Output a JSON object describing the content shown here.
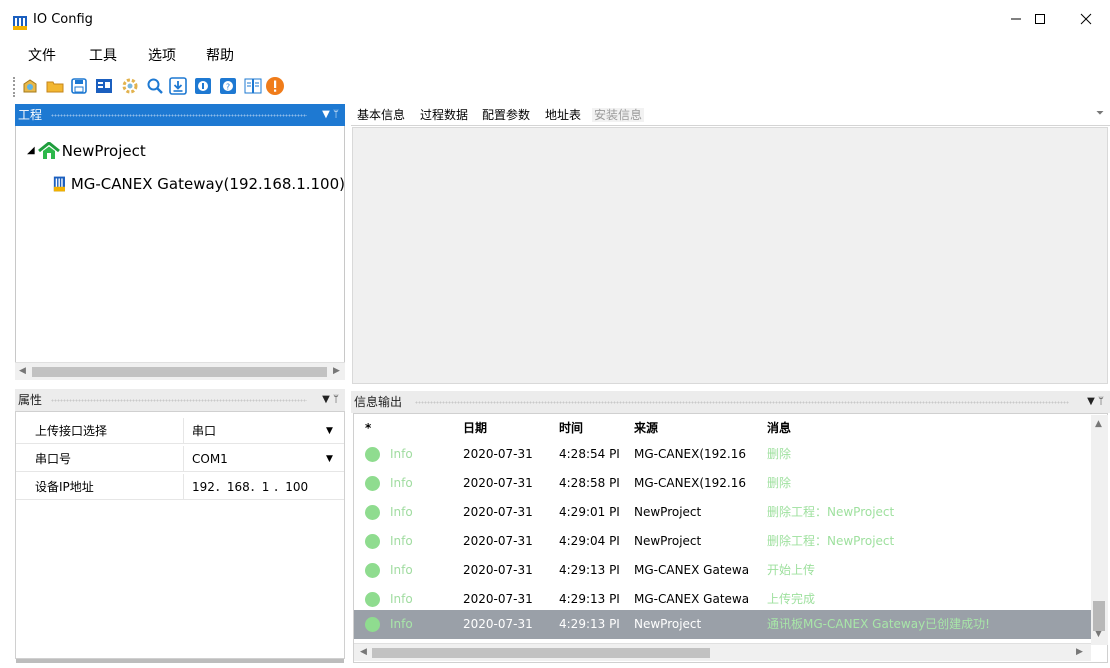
{
  "window": {
    "title": "IO Config"
  },
  "menu": [
    "文件",
    "工具",
    "选项",
    "帮助"
  ],
  "toolbar": [
    "new-project-icon",
    "open-folder-icon",
    "save-icon",
    "config-icon",
    "settings-gear-icon",
    "search-icon",
    "download-icon",
    "info-icon",
    "help-icon",
    "manual-icon",
    "warning-icon"
  ],
  "project_panel": {
    "title": "工程",
    "root": "NewProject",
    "child": "MG-CANEX Gateway(192.168.1.100)"
  },
  "tabs": [
    "基本信息",
    "过程数据",
    "配置参数",
    "地址表",
    "安装信息"
  ],
  "properties_panel": {
    "title": "属性",
    "rows": [
      {
        "label": "上传接口选择",
        "value": "串口",
        "dropdown": true
      },
      {
        "label": "串口号",
        "value": "COM1",
        "dropdown": true
      },
      {
        "label": "设备IP地址",
        "value": "192．168．1 ．100",
        "dropdown": false
      }
    ]
  },
  "info_panel": {
    "title": "信息输出",
    "columns": [
      "*",
      "日期",
      "时间",
      "来源",
      "消息"
    ],
    "rows": [
      {
        "level": "Info",
        "date": "2020-07-31",
        "time": "4:28:54 PI",
        "source": "MG-CANEX(192.16",
        "message": "删除"
      },
      {
        "level": "Info",
        "date": "2020-07-31",
        "time": "4:28:58 PI",
        "source": "MG-CANEX(192.16",
        "message": "删除"
      },
      {
        "level": "Info",
        "date": "2020-07-31",
        "time": "4:29:01 PI",
        "source": "NewProject",
        "message": "删除工程：NewProject"
      },
      {
        "level": "Info",
        "date": "2020-07-31",
        "time": "4:29:04 PI",
        "source": "NewProject",
        "message": "删除工程：NewProject"
      },
      {
        "level": "Info",
        "date": "2020-07-31",
        "time": "4:29:13 PI",
        "source": "MG-CANEX Gatewa",
        "message": "开始上传"
      },
      {
        "level": "Info",
        "date": "2020-07-31",
        "time": "4:29:13 PI",
        "source": "MG-CANEX Gatewa",
        "message": "上传完成"
      },
      {
        "level": "Info",
        "date": "2020-07-31",
        "time": "4:29:13 PI",
        "source": "NewProject",
        "message": "通讯板MG-CANEX Gateway已创建成功!"
      }
    ]
  },
  "colors": {
    "accent": "#1e79d2",
    "info_dot": "#8fdc8f",
    "selected_row": "#9aa0a8"
  }
}
